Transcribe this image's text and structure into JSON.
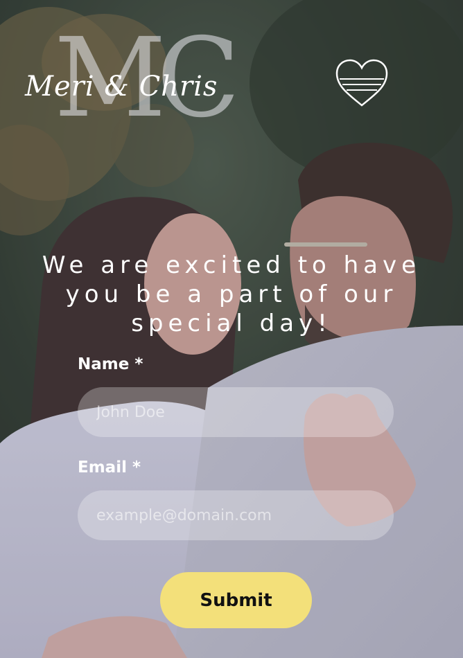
{
  "logo": {
    "monogram": "MC",
    "script": "Meri & Chris"
  },
  "headline": "We are excited to have you be a part of our special day!",
  "form": {
    "name_label": "Name *",
    "name_placeholder": "John Doe",
    "email_label": "Email *",
    "email_placeholder": "example@domain.com",
    "submit_label": "Submit"
  },
  "icons": {
    "header": "heart-icon"
  },
  "colors": {
    "submit_bg": "#f3e07a",
    "text": "#ffffff"
  }
}
